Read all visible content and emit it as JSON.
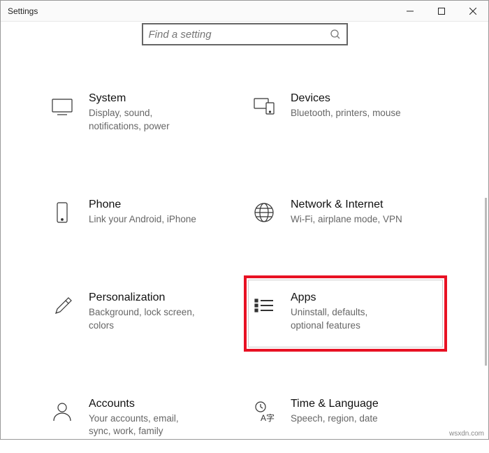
{
  "window": {
    "title": "Settings"
  },
  "search": {
    "placeholder": "Find a setting"
  },
  "tiles": {
    "system": {
      "name": "System",
      "desc": "Display, sound, notifications, power"
    },
    "devices": {
      "name": "Devices",
      "desc": "Bluetooth, printers, mouse"
    },
    "phone": {
      "name": "Phone",
      "desc": "Link your Android, iPhone"
    },
    "network": {
      "name": "Network & Internet",
      "desc": "Wi-Fi, airplane mode, VPN"
    },
    "personal": {
      "name": "Personalization",
      "desc": "Background, lock screen, colors"
    },
    "apps": {
      "name": "Apps",
      "desc": "Uninstall, defaults, optional features"
    },
    "accounts": {
      "name": "Accounts",
      "desc": "Your accounts, email, sync, work, family"
    },
    "time": {
      "name": "Time & Language",
      "desc": "Speech, region, date"
    }
  },
  "watermark": "wsxdn.com"
}
